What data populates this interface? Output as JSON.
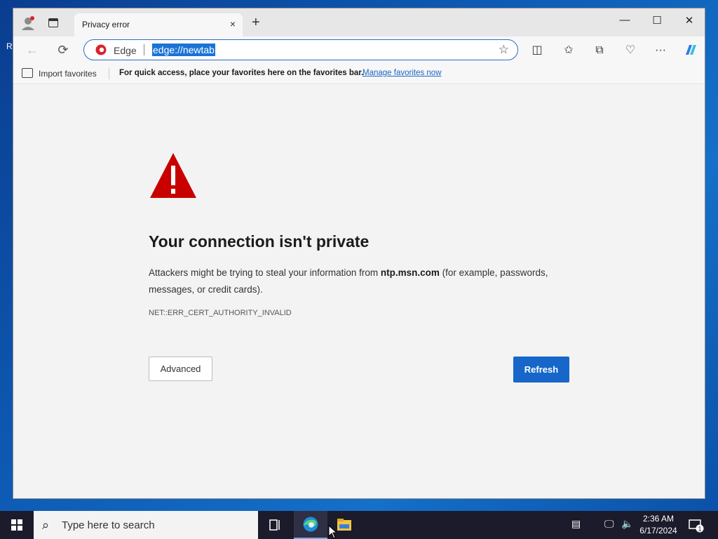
{
  "desktop": {
    "edge_letter": "R"
  },
  "tab": {
    "title": "Privacy error",
    "close": "×",
    "new": "+"
  },
  "window_controls": {
    "minimize": "—",
    "maximize": "☐",
    "close": "✕"
  },
  "address_bar": {
    "brand": "Edge",
    "url": "edge://newtab"
  },
  "favorites_bar": {
    "import_label": "Import favorites",
    "hint": "For quick access, place your favorites here on the favorites bar.",
    "manage_link": "Manage favorites now"
  },
  "error_page": {
    "heading": "Your connection isn't private",
    "description_pre": "Attackers might be trying to steal your information from ",
    "host": "ntp.msn.com",
    "description_post": " (for example, passwords, messages, or credit cards).",
    "error_code": "NET::ERR_CERT_AUTHORITY_INVALID",
    "advanced_label": "Advanced",
    "refresh_label": "Refresh",
    "accent_color": "#1766c9",
    "warning_color": "#c80000"
  },
  "taskbar": {
    "search_placeholder": "Type here to search",
    "time": "2:36 AM",
    "date": "6/17/2024",
    "notification_count": "1"
  }
}
